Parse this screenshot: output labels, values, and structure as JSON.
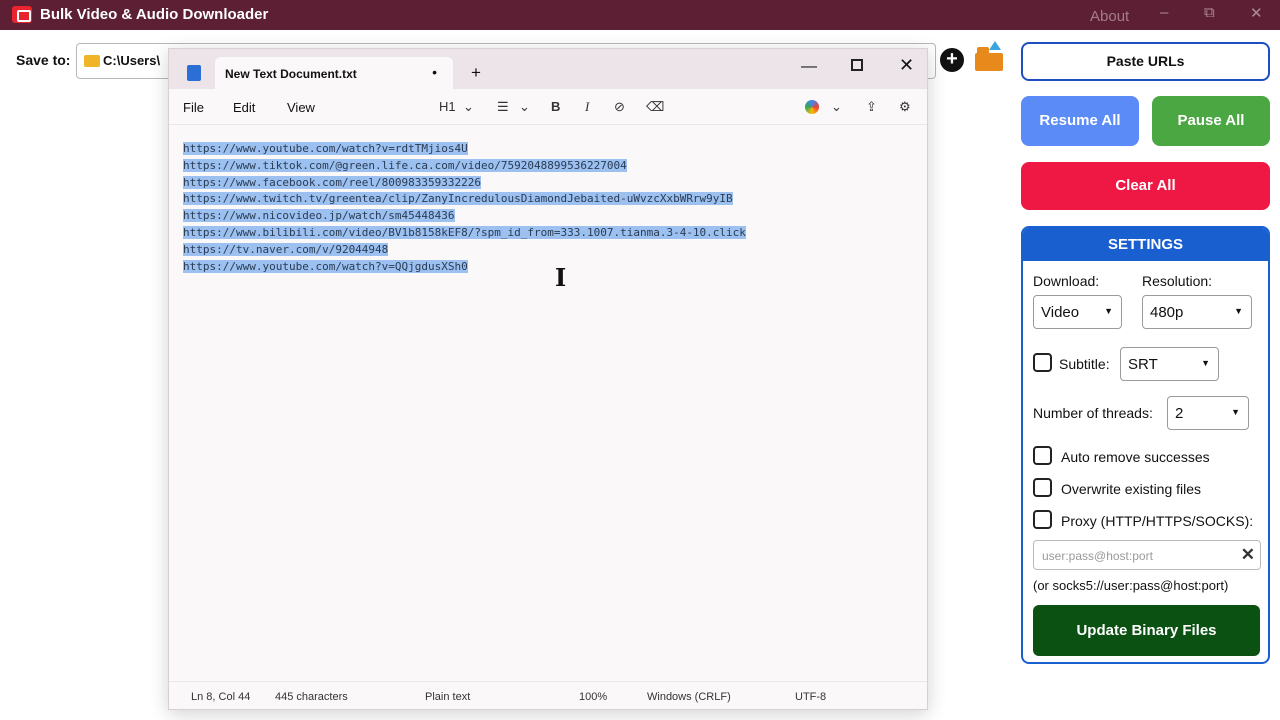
{
  "app": {
    "title": "Bulk Video & Audio Downloader",
    "about_label": "About",
    "minimize_glyph": "–",
    "maximize_glyph": "⧉",
    "close_glyph": "✕"
  },
  "save_row": {
    "label": "Save to:",
    "path": "C:\\Users\\",
    "add_glyph": "+"
  },
  "actions": {
    "paste_urls": "Paste URLs",
    "resume_all": "Resume All",
    "pause_all": "Pause All",
    "clear_all": "Clear All"
  },
  "colors": {
    "titlebar": "#5c1f33",
    "resume": "#5b8bf7",
    "pause": "#4aa742",
    "clear": "#ef1844",
    "settings": "#1a5fd0",
    "update": "#0b5112"
  },
  "settings": {
    "header": "SETTINGS",
    "download_label": "Download:",
    "download_value": "Video",
    "resolution_label": "Resolution:",
    "resolution_value": "480p",
    "subtitle_label": "Subtitle:",
    "subtitle_checked": false,
    "subtitle_value": "SRT",
    "threads_label": "Number of threads:",
    "threads_value": "2",
    "auto_remove_label": "Auto remove successes",
    "auto_remove_checked": false,
    "overwrite_label": "Overwrite existing files",
    "overwrite_checked": false,
    "proxy_label": "Proxy (HTTP/HTTPS/SOCKS):",
    "proxy_checked": false,
    "proxy_placeholder": "user:pass@host:port",
    "proxy_hint": "(or socks5://user:pass@host:port)",
    "clear_glyph": "✕",
    "update_button": "Update Binary Files"
  },
  "notepad": {
    "tab_title": "New Text Document.txt",
    "tab_unsaved": "•",
    "new_tab": "+",
    "win_minimize": "—",
    "win_close": "✕",
    "menu": [
      "File",
      "Edit",
      "View"
    ],
    "toolbar": {
      "heading": "H1",
      "heading_arrow": "⌄",
      "list": "☰",
      "list_arrow": "⌄",
      "bold": "B",
      "italic": "I",
      "link": "⊘",
      "clear_format": "⌫",
      "copilot_arrow": "⌄",
      "share": "⇪",
      "settings": "⚙"
    },
    "lines": [
      "https://www.youtube.com/watch?v=rdtTMjios4U",
      "https://www.tiktok.com/@green.life.ca.com/video/7592048899536227004",
      "https://www.facebook.com/reel/800983359332226",
      "https://www.twitch.tv/greentea/clip/ZanyIncredulousDiamondJebaited-uWvzcXxbWRrw9yIB",
      "https://www.nicovideo.jp/watch/sm45448436",
      "https://www.bilibili.com/video/BV1b8158kEF8/?spm_id_from=333.1007.tianma.3-4-10.click",
      "https://tv.naver.com/v/92044948",
      "https://www.youtube.com/watch?v=QQjgdusXSh0"
    ],
    "status": {
      "position": "Ln 8, Col 44",
      "chars": "445 characters",
      "mode": "Plain text",
      "zoom": "100%",
      "line_ending": "Windows (CRLF)",
      "encoding": "UTF-8"
    }
  }
}
